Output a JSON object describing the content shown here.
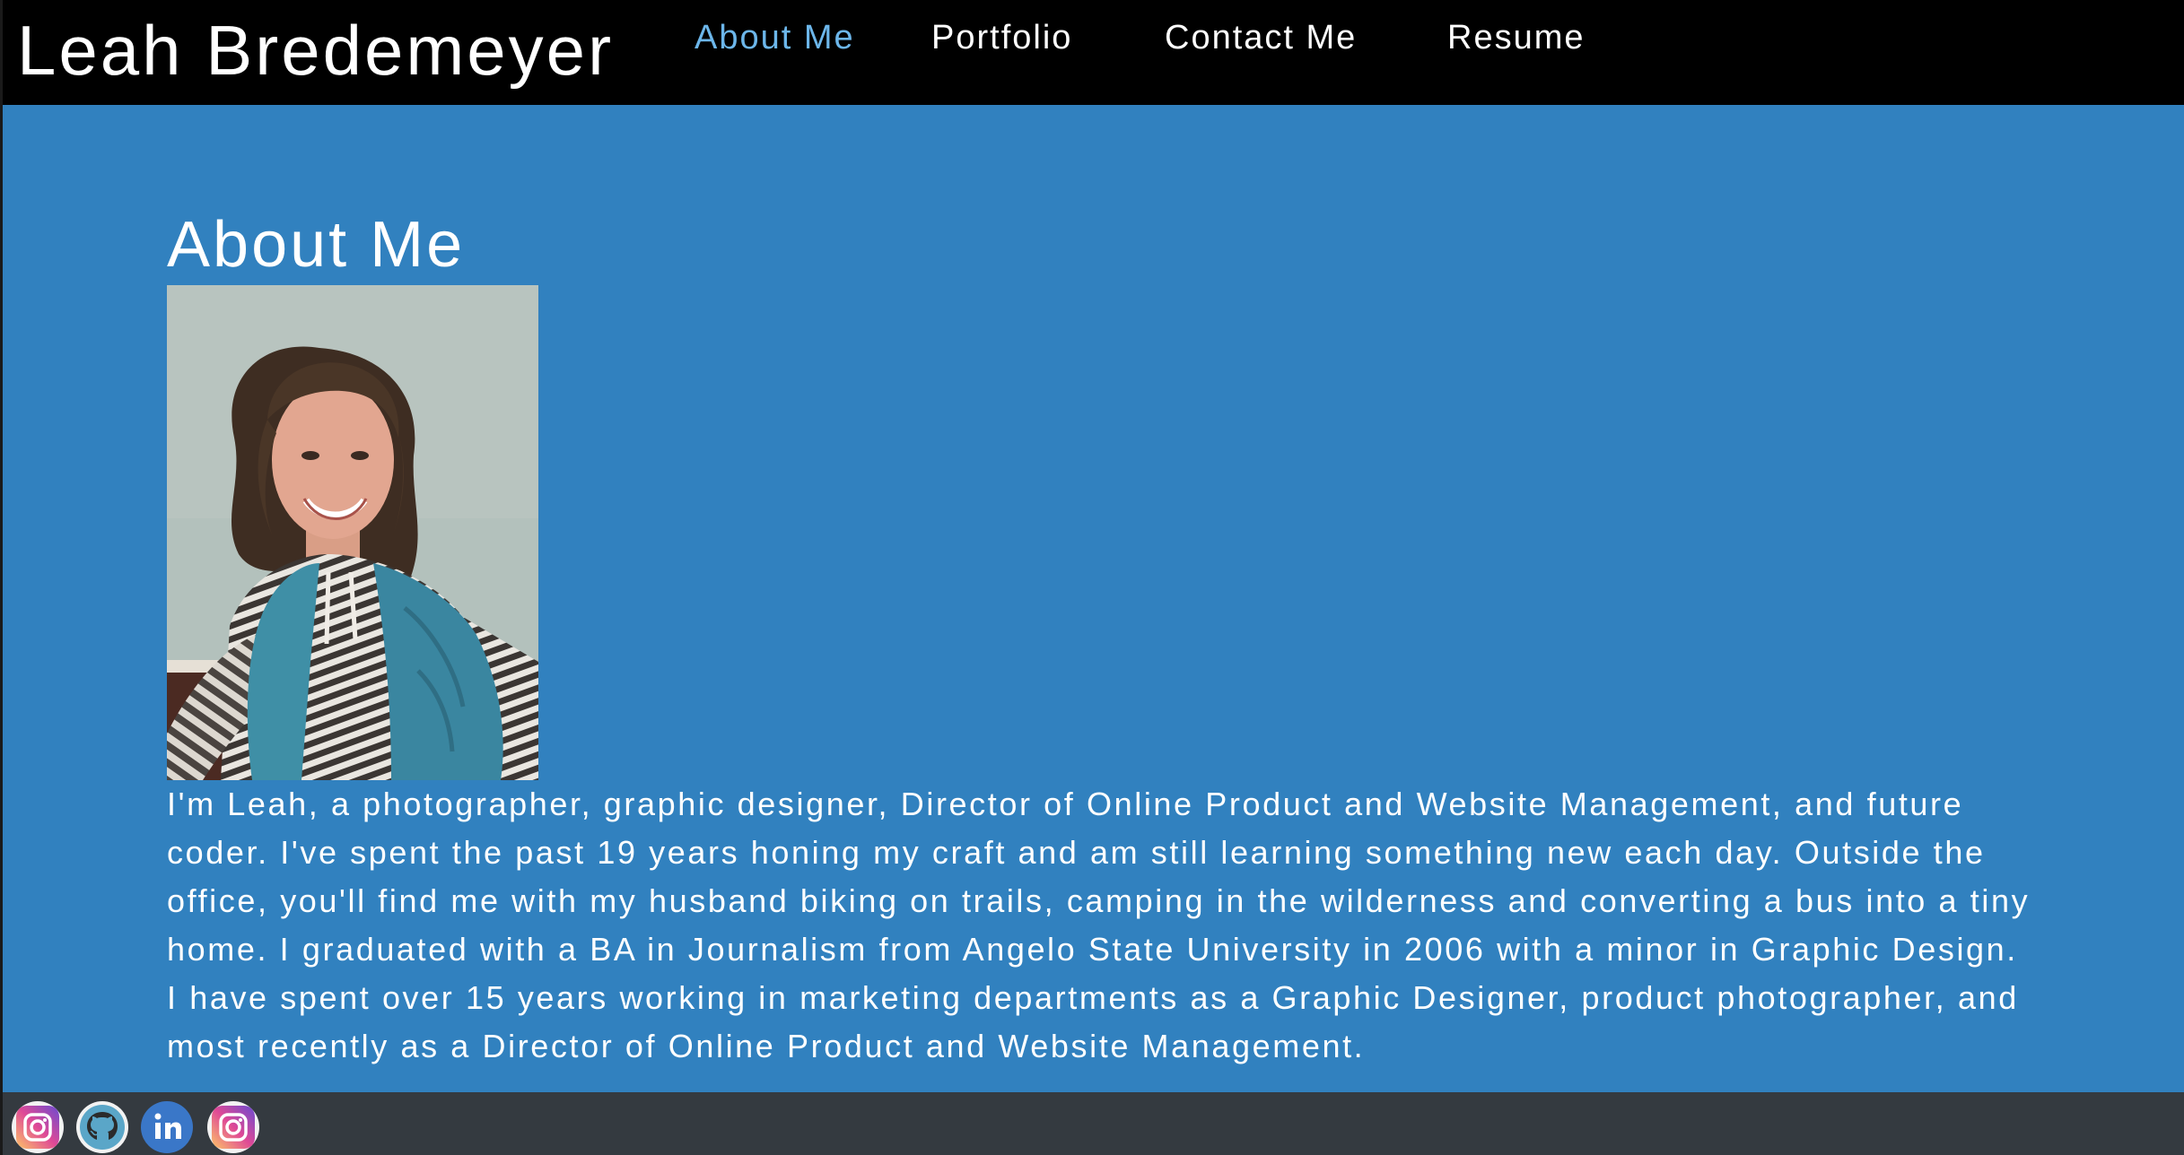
{
  "header": {
    "brand": "Leah Bredemeyer",
    "nav": [
      {
        "label": "About Me",
        "active": true
      },
      {
        "label": "Portfolio",
        "active": false
      },
      {
        "label": "Contact Me",
        "active": false
      },
      {
        "label": "Resume",
        "active": false
      }
    ]
  },
  "main": {
    "title": "About Me",
    "photo_icon": "portrait-photo",
    "bio": "I'm Leah, a photographer, graphic designer, Director of Online Product and Website Management, and future coder. I've spent the past 19 years honing my craft and am still learning something new each day. Outside the office, you'll find me with my husband biking on trails, camping in the wilderness and converting a bus into a tiny home. I graduated with a BA in Journalism from Angelo State University in 2006 with a minor in Graphic Design. I have spent over 15 years working in marketing departments as a Graphic Designer, product photographer, and most recently as a Director of Online Product and Website Management."
  },
  "footer": {
    "icons": [
      "instagram-icon",
      "github-icon",
      "linkedin-icon",
      "instagram-icon"
    ]
  },
  "colors": {
    "header_bg": "#000000",
    "page_bg": "#3181bf",
    "active_nav": "#6cb6ea",
    "footer_bg": "#343a40"
  }
}
